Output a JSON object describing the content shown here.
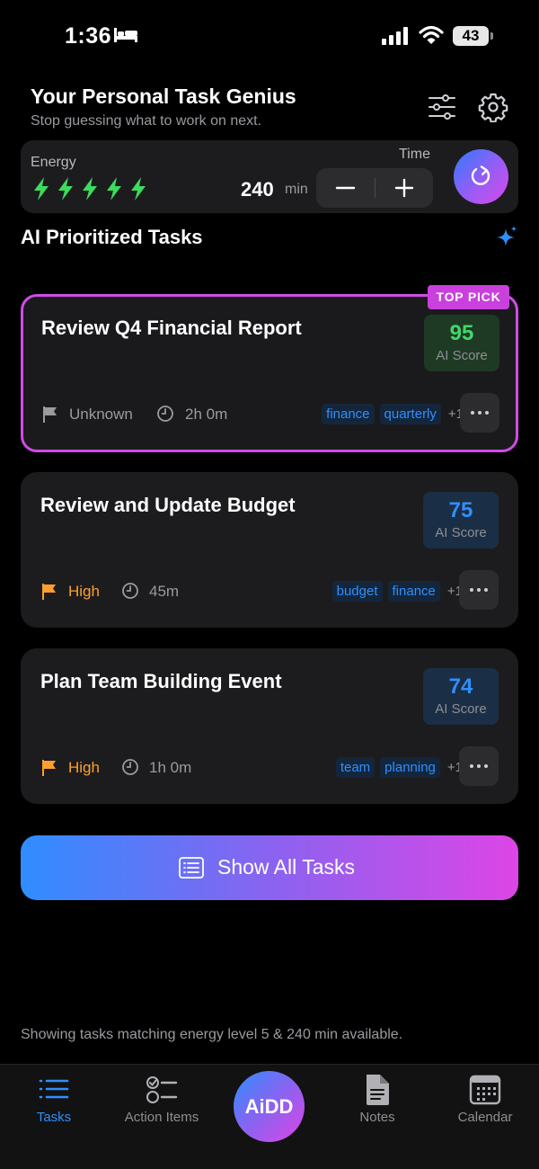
{
  "status_bar": {
    "time": "1:36",
    "battery": "43"
  },
  "header": {
    "title": "Your Personal Task Genius",
    "subtitle": "Stop guessing what to work on next."
  },
  "controls": {
    "energy_label": "Energy",
    "energy_level": 5,
    "time_label": "Time",
    "time_value": "240",
    "time_unit": "min"
  },
  "section_title": "AI Prioritized Tasks",
  "top_pick_badge": "TOP PICK",
  "tasks": [
    {
      "title": "Review Q4 Financial Report",
      "score": "95",
      "score_label": "AI Score",
      "priority": "Unknown",
      "duration": "2h 0m",
      "tags": [
        "finance",
        "quarterly"
      ],
      "more_tags": "+1"
    },
    {
      "title": "Review and Update Budget",
      "score": "75",
      "score_label": "AI Score",
      "priority": "High",
      "duration": "45m",
      "tags": [
        "budget",
        "finance"
      ],
      "more_tags": "+1"
    },
    {
      "title": "Plan Team Building Event",
      "score": "74",
      "score_label": "AI Score",
      "priority": "High",
      "duration": "1h 0m",
      "tags": [
        "team",
        "planning"
      ],
      "more_tags": "+1"
    }
  ],
  "show_all_label": "Show All Tasks",
  "footnote": "Showing tasks matching energy level 5 & 240 min available.",
  "tab_bar": {
    "tasks": "Tasks",
    "action_items": "Action Items",
    "center": "AiDD",
    "notes": "Notes",
    "calendar": "Calendar"
  },
  "colors": {
    "accent_blue": "#2f8fff",
    "accent_magenta": "#d14be6",
    "energy_green": "#3ddc5c",
    "score_green": "#43d66a",
    "priority_high": "#ff9f2d"
  }
}
